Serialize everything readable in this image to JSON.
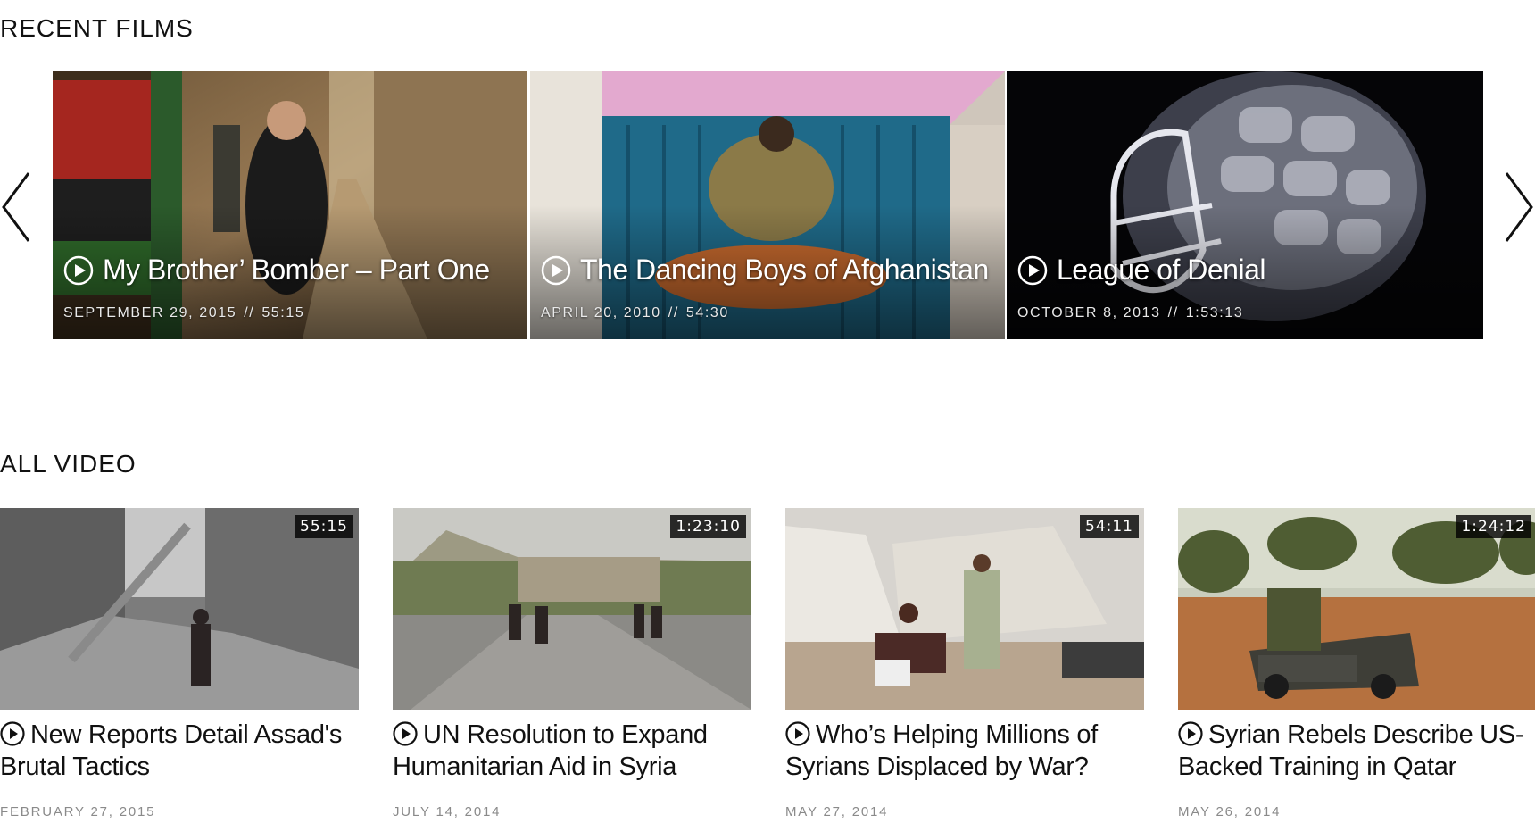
{
  "recent_films": {
    "heading": "RECENT FILMS",
    "prev_icon": "chevron-left-icon",
    "next_icon": "chevron-right-icon",
    "items": [
      {
        "title": "My Brother’ Bomber – Part One",
        "date": "SEPTEMBER 29, 2015",
        "separator": "//",
        "duration": "55:15"
      },
      {
        "title": "The Dancing Boys of Afghanistan",
        "date": "APRIL 20, 2010",
        "separator": "//",
        "duration": "54:30"
      },
      {
        "title": "League of Denial",
        "date": "OCTOBER 8, 2013",
        "separator": "//",
        "duration": "1:53:13"
      }
    ]
  },
  "all_video": {
    "heading": "ALL VIDEO",
    "items": [
      {
        "title": "New Reports Detail Assad's Brutal Tactics",
        "date": "FEBRUARY 27, 2015",
        "duration": "55:15"
      },
      {
        "title": "UN Resolution to Expand Humanitarian Aid in Syria",
        "date": "JULY 14, 2014",
        "duration": "1:23:10"
      },
      {
        "title": "Who’s Helping Millions of Syrians Displaced by War?",
        "date": "MAY 27, 2014",
        "duration": "54:11"
      },
      {
        "title": "Syrian Rebels Describe US-Backed Training in Qatar",
        "date": "MAY 26, 2014",
        "duration": "1:24:12"
      }
    ]
  },
  "colors": {
    "text": "#111111",
    "meta_gray": "#8a8a8a",
    "badge_bg": "#000000"
  }
}
